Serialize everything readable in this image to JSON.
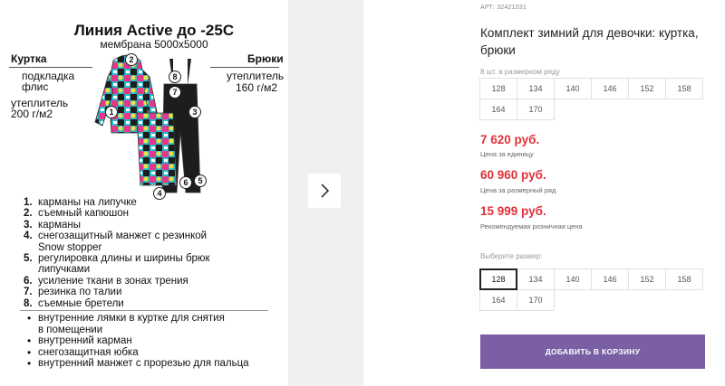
{
  "product_card": {
    "title": "Линия Active до -25С",
    "subtitle": "мембрана 5000x5000",
    "jacket": {
      "heading": "Куртка",
      "lining": "подкладка",
      "fleece": "флис",
      "insulation": "утеплитель",
      "insulation_value": "200 г/м2"
    },
    "pants": {
      "heading": "Брюки",
      "insulation": "утеплитель",
      "insulation_value": "160 г/м2"
    },
    "callouts": [
      "1",
      "2",
      "3",
      "4",
      "5",
      "6",
      "7",
      "8"
    ],
    "features_numbered": [
      {
        "n": "1.",
        "text": "карманы на липучке"
      },
      {
        "n": "2.",
        "text": "съемный капюшон"
      },
      {
        "n": "3.",
        "text": "карманы"
      },
      {
        "n": "4.",
        "text": "снегозащитный манжет с резинкой"
      },
      {
        "n": "",
        "text": "Snow stopper"
      },
      {
        "n": "5.",
        "text": "регулировка длины и ширины брюк"
      },
      {
        "n": "",
        "text": "липучками"
      },
      {
        "n": "6.",
        "text": "усиление ткани в зонах трения"
      },
      {
        "n": "7.",
        "text": "резинка по талии"
      },
      {
        "n": "8.",
        "text": "съемные бретели"
      }
    ],
    "features_bulleted": [
      {
        "d": "•",
        "text": "внутренние лямки в куртке для снятия"
      },
      {
        "d": "",
        "text": "в помещении"
      },
      {
        "d": "•",
        "text": "внутренний карман"
      },
      {
        "d": "•",
        "text": "снегозащитная юбка"
      },
      {
        "d": "•",
        "text": "внутренний манжет с прорезью для пальца"
      }
    ]
  },
  "gallery": {
    "next_icon": "chevron-right-icon"
  },
  "product": {
    "article": "АРТ: 32421031",
    "title": "Комплект зимний для девочки: куртка, брюки",
    "size_row_label": "8 шт. в размерном ряду",
    "size_row": [
      "128",
      "134",
      "140",
      "146",
      "152",
      "158",
      "164",
      "170"
    ],
    "price_unit": "7 620 руб.",
    "price_unit_note": "Цена за единицу",
    "price_row": "60 960 руб.",
    "price_row_note": "Цена за размерный ряд",
    "price_retail": "15 999 руб.",
    "price_retail_note": "Рекомендуемая розничная цена",
    "choose_size_label": "Выберите размер:",
    "sizes": [
      "128",
      "134",
      "140",
      "146",
      "152",
      "158",
      "164",
      "170"
    ],
    "selected_size": "128",
    "add_to_cart": "ДОБАВИТЬ В КОРЗИНУ"
  },
  "colors": {
    "price": "#e0323a",
    "button": "#7a5fa4"
  }
}
